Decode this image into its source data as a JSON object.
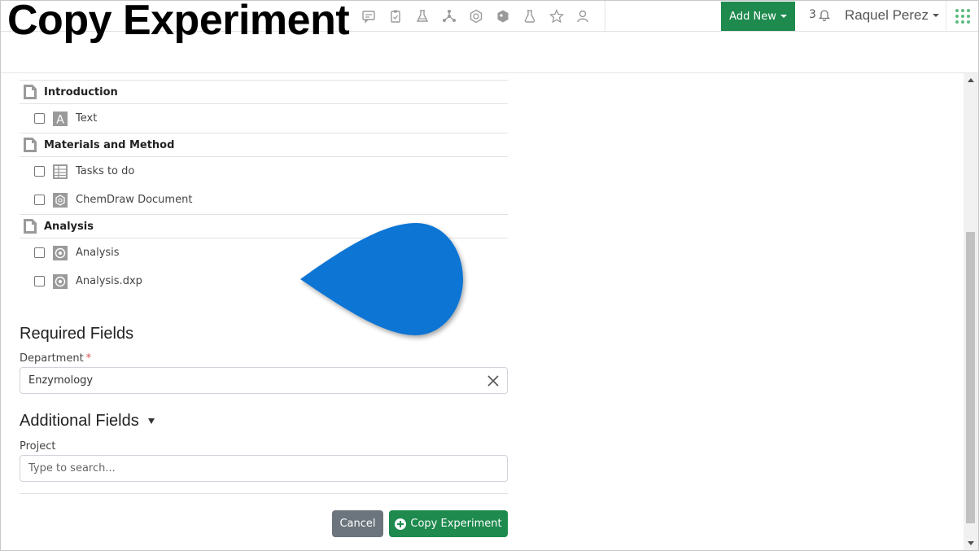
{
  "overlay_title": "Copy Experiment",
  "navbar": {
    "icons": [
      "comment-icon",
      "clipboard-icon",
      "lab-icon",
      "molecule-icon",
      "chemdraw-icon",
      "tag-icon",
      "flask-icon",
      "star-icon",
      "user-search-icon"
    ],
    "add_new_label": "Add New",
    "notification_count": "3",
    "user_name": "Raquel Perez"
  },
  "sections": [
    {
      "title": "Introduction",
      "items": [
        {
          "label": "Text",
          "icon": "text-icon"
        }
      ]
    },
    {
      "title": "Materials and Method",
      "items": [
        {
          "label": "Tasks to do",
          "icon": "table-icon"
        },
        {
          "label": "ChemDraw Document",
          "icon": "chemdraw-icon"
        }
      ]
    },
    {
      "title": "Analysis",
      "items": [
        {
          "label": "Analysis",
          "icon": "analysis-icon"
        },
        {
          "label": "Analysis.dxp",
          "icon": "analysis-icon"
        }
      ]
    }
  ],
  "required_fields": {
    "heading": "Required Fields",
    "department_label": "Department",
    "required_marker": "*",
    "department_value": "Enzymology"
  },
  "additional_fields": {
    "heading": "Additional Fields",
    "project_label": "Project",
    "project_placeholder": "Type to search..."
  },
  "buttons": {
    "cancel": "Cancel",
    "copy": "Copy Experiment"
  },
  "colors": {
    "accent_green": "#1e8a4e",
    "pointer_blue": "#0a74d4",
    "cancel_gray": "#6c757d"
  }
}
